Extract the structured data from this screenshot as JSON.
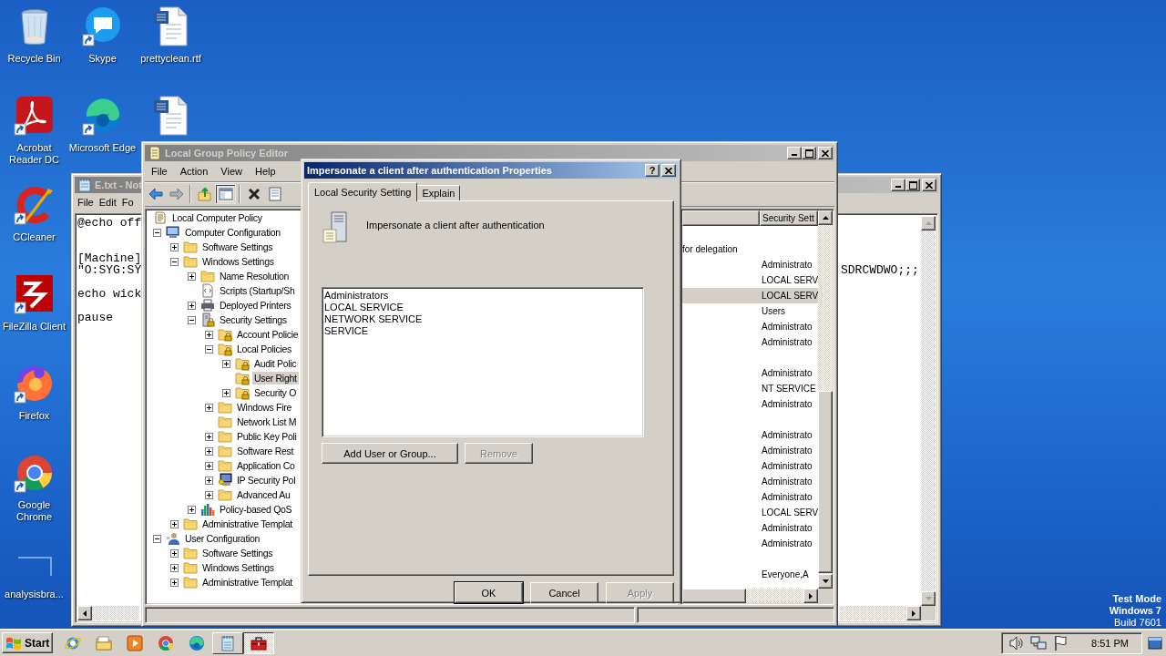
{
  "desktop": {
    "icon_columns": [
      [
        {
          "label": "Recycle Bin",
          "kind": "recycle-bin",
          "shortcut": false
        },
        {
          "label": "Acrobat Reader DC",
          "kind": "acrobat",
          "shortcut": true
        },
        {
          "label": "CCleaner",
          "kind": "ccleaner",
          "shortcut": true
        },
        {
          "label": "FileZilla Client",
          "kind": "filezilla",
          "shortcut": true
        },
        {
          "label": "Firefox",
          "kind": "firefox",
          "shortcut": true
        },
        {
          "label": "Google Chrome",
          "kind": "chrome",
          "shortcut": true
        },
        {
          "label": "analysisbra...",
          "kind": "blank",
          "shortcut": false
        }
      ],
      [
        {
          "label": "Skype",
          "kind": "skype",
          "shortcut": true
        },
        {
          "label": "Microsoft Edge",
          "kind": "edge",
          "shortcut": true
        }
      ],
      [
        {
          "label": "prettyclean.rtf",
          "kind": "word-doc",
          "shortcut": false
        },
        {
          "kind": "word-doc",
          "shortcut": false
        }
      ]
    ],
    "os_notice": [
      "Test Mode",
      "Windows 7",
      "Build 7601"
    ]
  },
  "notepad": {
    "title": "E.txt - Not",
    "active": false,
    "menu": [
      "File",
      "Edit",
      "Fo"
    ],
    "lines": [
      {
        "kind": "text",
        "text": "@echo off"
      },
      {
        "kind": "blank"
      },
      {
        "kind": "blank"
      },
      {
        "kind": "text",
        "text": "[Machine]"
      },
      {
        "kind": "text",
        "text": "\"O:SYG:SY",
        "tail": "SDRCWDWO;;;"
      },
      {
        "kind": "blank"
      },
      {
        "kind": "text",
        "text": "echo wick"
      },
      {
        "kind": "blank"
      },
      {
        "kind": "text",
        "text": "pause"
      }
    ]
  },
  "gpe": {
    "title": "Local Group Policy Editor",
    "active": false,
    "menu": [
      "File",
      "Action",
      "View",
      "Help"
    ],
    "toolbar": [
      {
        "kind": "back",
        "pressed": false
      },
      {
        "kind": "forward",
        "pressed": false
      },
      {
        "kind": "separator"
      },
      {
        "kind": "up",
        "pressed": false
      },
      {
        "kind": "tree-toggle",
        "pressed": true
      },
      {
        "kind": "separator"
      },
      {
        "kind": "delete",
        "pressed": false
      },
      {
        "kind": "properties",
        "pressed": false
      }
    ],
    "tree": [
      {
        "label": "Local Computer Policy",
        "kind": "policy",
        "selected": false,
        "children": [
          {
            "label": "Computer Configuration",
            "kind": "computer",
            "expanded": true,
            "selected": false,
            "children": [
              {
                "label": "Software Settings",
                "kind": "folder",
                "expanded": false,
                "selected": false
              },
              {
                "label": "Windows Settings",
                "kind": "folder",
                "expanded": true,
                "selected": false,
                "children": [
                  {
                    "label": "Name Resolution",
                    "kind": "folder",
                    "expanded": false,
                    "selected": false
                  },
                  {
                    "label": "Scripts (Startup/Sh",
                    "kind": "script",
                    "selected": false
                  },
                  {
                    "label": "Deployed Printers",
                    "kind": "printer",
                    "expanded": false,
                    "selected": false
                  },
                  {
                    "label": "Security Settings",
                    "kind": "security",
                    "expanded": true,
                    "selected": false,
                    "children": [
                      {
                        "label": "Account Policie",
                        "kind": "folder-lock",
                        "expanded": false,
                        "selected": false
                      },
                      {
                        "label": "Local Policies",
                        "kind": "folder-lock",
                        "expanded": true,
                        "selected": false,
                        "children": [
                          {
                            "label": "Audit Polic",
                            "kind": "folder-lock",
                            "expanded": false,
                            "selected": false
                          },
                          {
                            "label": "User Right",
                            "kind": "folder-lock",
                            "selected": true
                          },
                          {
                            "label": "Security O",
                            "kind": "folder-lock",
                            "expanded": false,
                            "selected": false
                          }
                        ]
                      },
                      {
                        "label": "Windows Fire",
                        "kind": "folder",
                        "expanded": false,
                        "selected": false
                      },
                      {
                        "label": "Network List M",
                        "kind": "folder",
                        "selected": false
                      },
                      {
                        "label": "Public Key Poli",
                        "kind": "folder",
                        "expanded": false,
                        "selected": false
                      },
                      {
                        "label": "Software Rest",
                        "kind": "folder",
                        "expanded": false,
                        "selected": false
                      },
                      {
                        "label": "Application Co",
                        "kind": "folder",
                        "expanded": false,
                        "selected": false
                      },
                      {
                        "label": "IP Security Pol",
                        "kind": "ipsec",
                        "expanded": false,
                        "selected": false
                      },
                      {
                        "label": "Advanced Au",
                        "kind": "folder",
                        "expanded": false,
                        "selected": false
                      }
                    ]
                  },
                  {
                    "label": "Policy-based QoS",
                    "kind": "qos",
                    "expanded": false,
                    "selected": false
                  }
                ]
              },
              {
                "label": "Administrative Templat",
                "kind": "folder",
                "expanded": false,
                "selected": false
              }
            ]
          },
          {
            "label": "User Configuration",
            "kind": "user",
            "expanded": true,
            "selected": false,
            "children": [
              {
                "label": "Software Settings",
                "kind": "folder",
                "expanded": false,
                "selected": false
              },
              {
                "label": "Windows Settings",
                "kind": "folder",
                "expanded": false,
                "selected": false
              },
              {
                "label": "Administrative Templat",
                "kind": "folder",
                "expanded": false,
                "selected": false
              }
            ]
          }
        ]
      }
    ],
    "settings_header": "Security Sett",
    "rows": [
      {
        "selected": false
      },
      {
        "policy": "for delegation",
        "selected": false
      },
      {
        "setting": "Administrato",
        "selected": false
      },
      {
        "setting": "LOCAL SERV",
        "selected": false
      },
      {
        "setting": "LOCAL SERV",
        "selected": true
      },
      {
        "setting": "Users",
        "selected": false
      },
      {
        "setting": "Administrato",
        "selected": false
      },
      {
        "setting": "Administrato",
        "selected": false
      },
      {
        "selected": false
      },
      {
        "setting": "Administrato",
        "selected": false
      },
      {
        "setting": "NT SERVICE",
        "selected": false
      },
      {
        "setting": "Administrato",
        "selected": false
      },
      {
        "selected": false
      },
      {
        "setting": "Administrato",
        "selected": false
      },
      {
        "setting": "Administrato",
        "selected": false
      },
      {
        "setting": "Administrato",
        "selected": false
      },
      {
        "setting": "Administrato",
        "selected": false
      },
      {
        "setting": "Administrato",
        "selected": false
      },
      {
        "setting": "LOCAL SERV",
        "selected": false
      },
      {
        "setting": "Administrato",
        "selected": false
      },
      {
        "setting": "Administrato",
        "selected": false
      },
      {
        "selected": false
      },
      {
        "setting": "Everyone,A",
        "selected": false
      }
    ]
  },
  "dialog": {
    "title": "Impersonate a client after authentication Properties",
    "active": true,
    "help_button": "?",
    "tabs": [
      {
        "label": "Local Security Setting",
        "selected": true
      },
      {
        "label": "Explain",
        "selected": false
      }
    ],
    "policy_name": "Impersonate a client after authentication",
    "members": [
      {
        "label": "Administrators",
        "selected": false
      },
      {
        "label": "LOCAL SERVICE",
        "selected": false
      },
      {
        "label": "NETWORK SERVICE",
        "selected": false
      },
      {
        "label": "SERVICE",
        "selected": false
      }
    ],
    "buttons": [
      {
        "label": "Add User or Group...",
        "disabled": false
      },
      {
        "label": "Remove",
        "disabled": true
      }
    ],
    "footer_buttons": [
      {
        "label": "OK",
        "disabled": false,
        "default": true
      },
      {
        "label": "Cancel",
        "disabled": false,
        "default": false
      },
      {
        "label": "Apply",
        "disabled": true,
        "default": false
      }
    ]
  },
  "taskbar": {
    "start": "Start",
    "items": [
      {
        "kind": "ie",
        "running": false,
        "active": false
      },
      {
        "kind": "explorer",
        "running": false,
        "active": false
      },
      {
        "kind": "media",
        "running": false,
        "active": false
      },
      {
        "kind": "chrome",
        "running": false,
        "active": false
      },
      {
        "kind": "edge",
        "running": false,
        "active": false
      },
      {
        "kind": "notepad",
        "running": true,
        "active": false
      },
      {
        "kind": "toolbox",
        "running": true,
        "active": true
      }
    ],
    "tray": [
      {
        "kind": "speaker"
      },
      {
        "kind": "network"
      },
      {
        "kind": "flag"
      }
    ],
    "clock": "8:51 PM"
  }
}
